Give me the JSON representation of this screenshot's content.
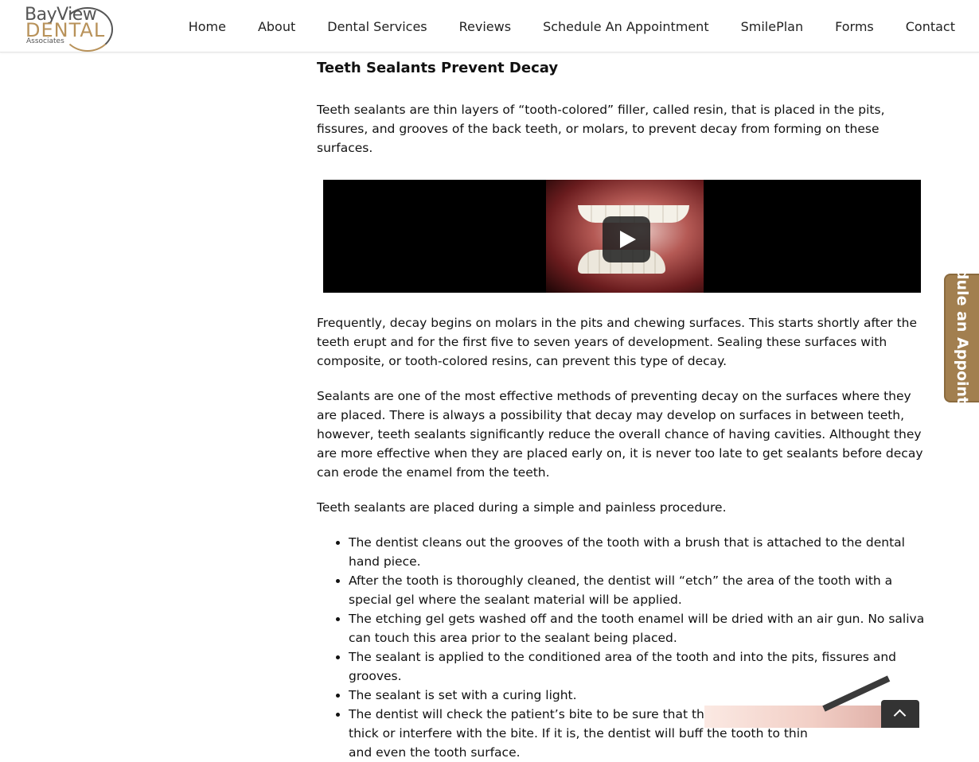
{
  "logo": {
    "line1": "BayView",
    "line2": "DENTAL",
    "line3": "Associates"
  },
  "nav": {
    "items": [
      "Home",
      "About",
      "Dental Services",
      "Reviews",
      "Schedule An Appointment",
      "SmilePlan",
      "Forms",
      "Contact"
    ]
  },
  "article": {
    "title": "Teeth Sealants Prevent Decay",
    "intro": "Teeth sealants are thin layers of “tooth-colored” filler, called resin, that is placed in the pits, fissures, and grooves of the back teeth, or molars, to prevent decay from forming on these surfaces.",
    "para2": "Frequently, decay begins on molars in the pits and chewing surfaces. This starts shortly after the teeth erupt and for the first five to seven years of development. Sealing these surfaces with composite, or tooth-colored resins, can prevent this type of decay.",
    "para3": "Sealants are one of the most effective methods of preventing decay on the surfaces where they are placed. There is always a possibility that decay may develop on surfaces in between teeth, however, teeth sealants significantly reduce the overall chance of having cavities. Althought they are more effective when they are placed early on, it is never too late to get sealants before decay can erode the enamel from the teeth.",
    "para4": "Teeth sealants are placed during a simple and painless procedure.",
    "steps": [
      "The dentist cleans out the grooves of the tooth with a brush that is attached to the dental hand piece.",
      "After the tooth is thoroughly cleaned, the dentist will “etch” the area of the tooth with a special gel where the sealant material will be applied.",
      "The etching gel gets washed off and the tooth enamel will be dried with an air gun.  No saliva can touch this area prior to the sealant being placed.",
      "The sealant is applied to the conditioned area of the tooth and into the pits, fissures and grooves.",
      "The sealant is set with a curing light.",
      "The dentist will check the patient’s bite to be sure that the sealant is not too thick or interfere with the bite.  If it is, the dentist will buff the tooth to thin and even the tooth surface."
    ]
  },
  "sidetab": {
    "label": "Schedule an Appointment"
  },
  "icons": {
    "play": "play-icon",
    "scroll_top": "chevron-up-icon"
  },
  "colors": {
    "brand_gold": "#a27f4f",
    "text": "#111111"
  }
}
